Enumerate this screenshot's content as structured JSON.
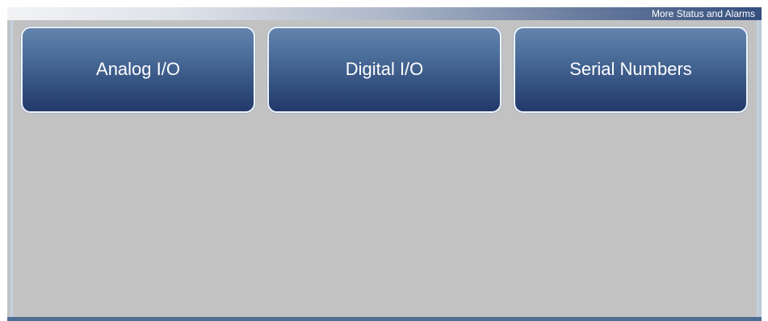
{
  "header": {
    "title": "More Status and Alarms"
  },
  "menu": {
    "buttons": [
      {
        "label": "Analog I/O"
      },
      {
        "label": "Digital I/O"
      },
      {
        "label": "Serial Numbers"
      }
    ]
  },
  "colors": {
    "background": "#c2c2c2",
    "button_top": "#6183ad",
    "button_bottom": "#22396a",
    "header_accent": "#344f7e",
    "bottom_strip": "#4d6d93"
  }
}
